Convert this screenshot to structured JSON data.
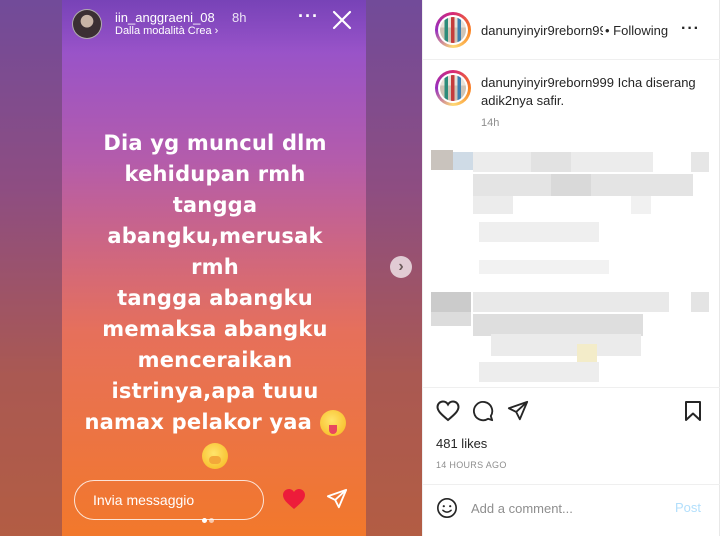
{
  "story": {
    "username": "iin_anggraeni_08",
    "time": "8h",
    "subtitle": "Dalla modalità Crea ›",
    "text_lines": [
      "Dia yg muncul dlm",
      "kehidupan rmh tangga",
      "abangku,merusak rmh",
      "tangga abangku",
      "memaksa abangku",
      "menceraikan",
      "istrinya,apa tuuu",
      "namax pelakor yaa"
    ],
    "more_glyph": "···",
    "next_glyph": "›",
    "reply_placeholder": "Invia messaggio",
    "icons": {
      "avatar": "profile-avatar-icon",
      "close": "close-icon",
      "more": "more-options-icon",
      "next": "chevron-right-icon",
      "heart": "heart-filled-icon",
      "send": "send-icon",
      "emoji1": "tongue-out-emoji",
      "emoji2": "hand-over-mouth-emoji"
    },
    "colors": {
      "gradient_top": "#8c4fd6",
      "gradient_bottom": "#f2782b",
      "heart": "#ed1c3a"
    }
  },
  "post": {
    "header_username": "danunyinyir9reborn999",
    "follow_label": "• Following",
    "more_glyph": "···",
    "caption_user": "danunyinyir9reborn999",
    "caption_text": "Icha diserang adik2nya safir.",
    "caption_time": "14h",
    "likes": "481 likes",
    "time_ago": "14 HOURS AGO",
    "comment_placeholder": "Add a comment...",
    "post_label": "Post",
    "icons": {
      "like": "heart-outline-icon",
      "comment": "comment-icon",
      "share": "send-icon",
      "save": "bookmark-icon",
      "emoji": "smiley-icon"
    },
    "colors": {
      "text": "#262626",
      "muted": "#8e8e8e",
      "post_disabled": "#b2dffc"
    }
  }
}
